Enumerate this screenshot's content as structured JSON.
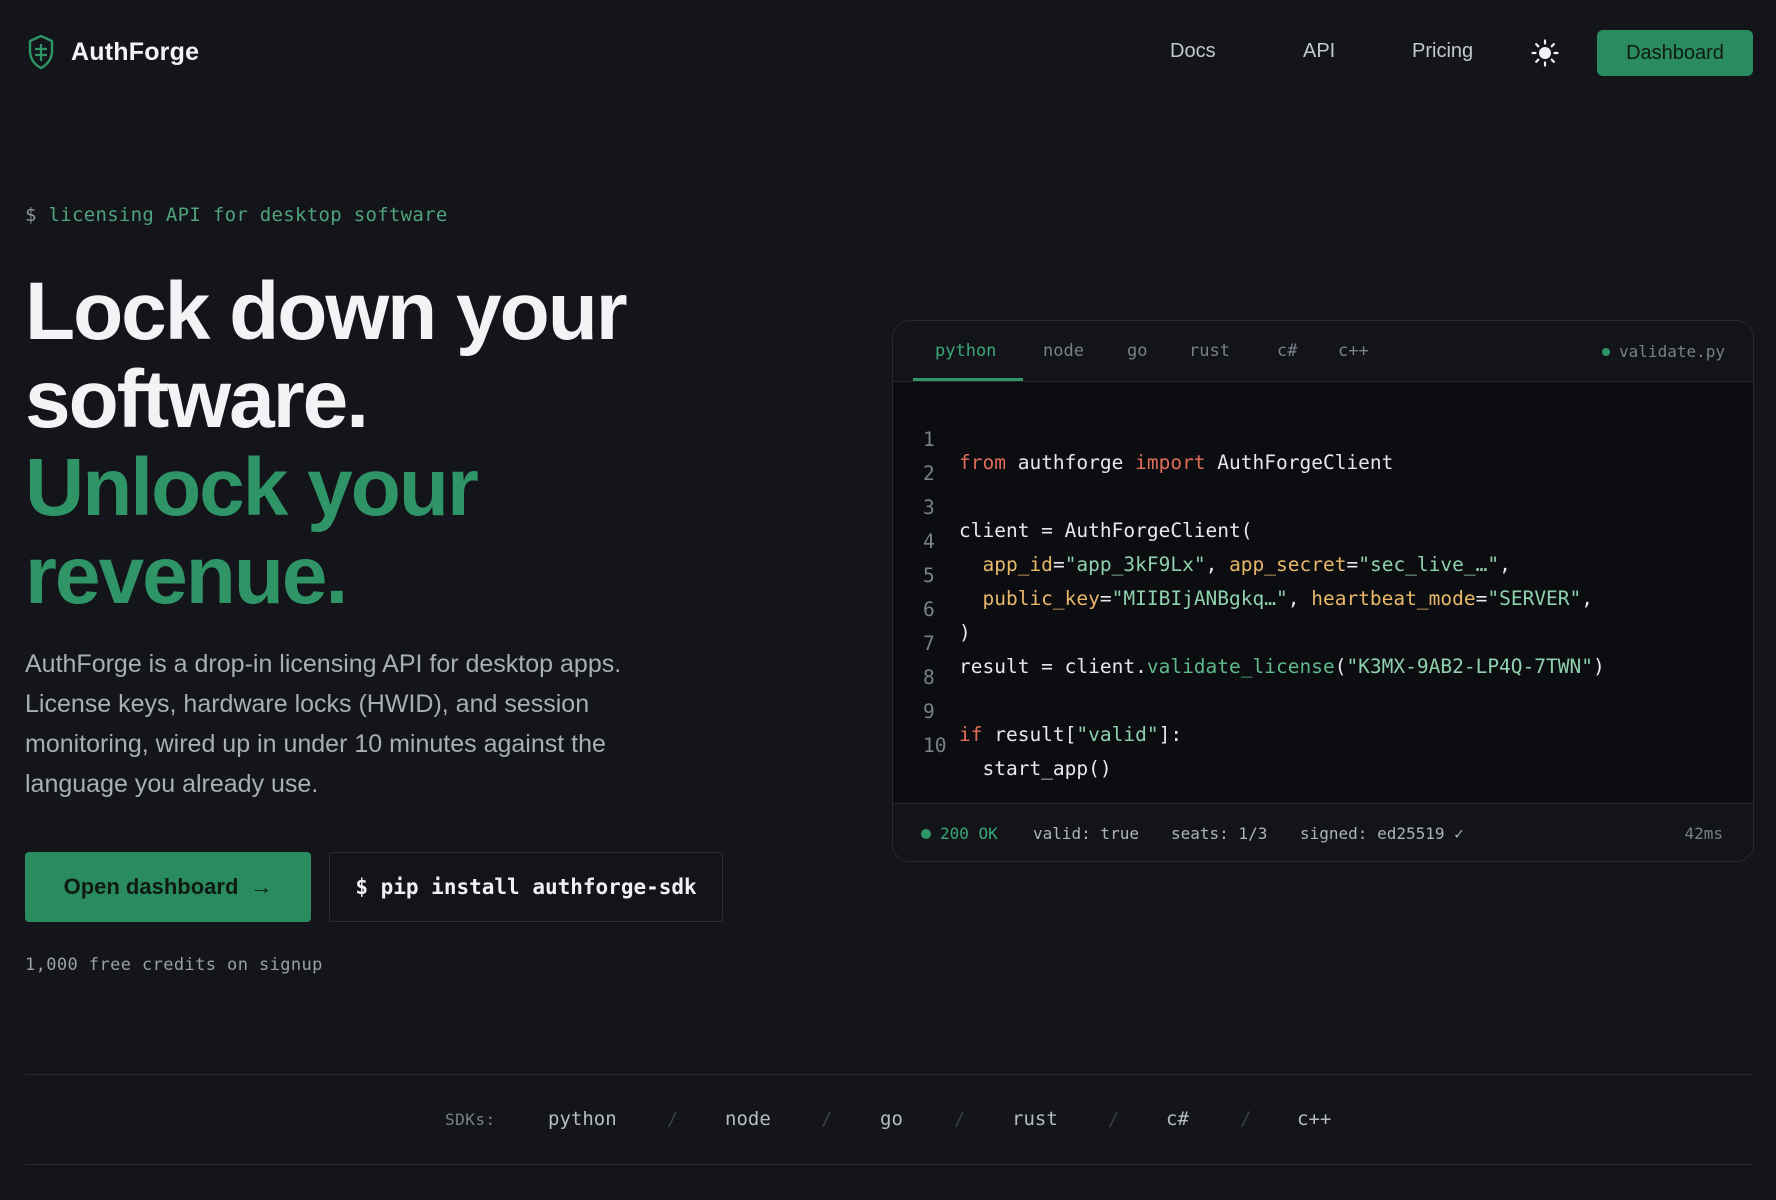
{
  "nav": {
    "brand": "AuthForge",
    "links": [
      "Docs",
      "API",
      "Pricing"
    ],
    "dashboard_label": "Dashboard"
  },
  "hero": {
    "prompt_symbol": "$",
    "prompt_text": "licensing API for desktop software",
    "headline_line1": "Lock down your software.",
    "headline_line2": "Unlock your revenue.",
    "lead": "AuthForge is a drop-in licensing API for desktop apps. License keys, hardware locks (HWID), and session monitoring, wired up in under 10 minutes against the language you already use.",
    "cta_label": "Open dashboard",
    "install_command": "$ pip install authforge-sdk",
    "free_note": "1,000 free credits on signup"
  },
  "code_card": {
    "tabs": [
      "python",
      "node",
      "go",
      "rust",
      "c#",
      "c++"
    ],
    "active_tab": "python",
    "filename": "validate.py",
    "line_numbers": [
      "1",
      "2",
      "3",
      "4",
      "5",
      "6",
      "7",
      "8",
      "9",
      "10"
    ],
    "status": {
      "code": "200 OK",
      "valid": "valid: true",
      "seats": "seats: 1/3",
      "signed": "signed: ed25519 ✓",
      "latency": "42ms"
    }
  },
  "code_tokens": {
    "l1_from": "from",
    "l1_mod": " authforge ",
    "l1_import": "import",
    "l1_cls": " AuthForgeClient",
    "l3": "client = AuthForgeClient(",
    "l4_p1": "app_id",
    "l4_v1": "\"app_3kF9Lx\"",
    "l4_p2": "app_secret",
    "l4_v2": "\"sec_live_…\"",
    "l5_p1": "public_key",
    "l5_v1": "\"MIIBIjANBgkq…\"",
    "l5_p2": "heartbeat_mode",
    "l5_v2": "\"SERVER\"",
    "l6": ")",
    "l7_a": "result = client.",
    "l7_fn": "validate_license",
    "l7_v": "\"K3MX-9AB2-LP4Q-7TWN\"",
    "l9_if": "if",
    "l9_a": " result[",
    "l9_v": "\"valid\"",
    "l9_b": "]:",
    "l10": "  start_app()"
  },
  "sdk_bar": {
    "label": "SDKs:",
    "items": [
      "python",
      "node",
      "go",
      "rust",
      "c#",
      "c++"
    ]
  },
  "colors": {
    "background": "#13151b",
    "accent": "#2a8c5e",
    "headline_green": "#2f9466"
  }
}
